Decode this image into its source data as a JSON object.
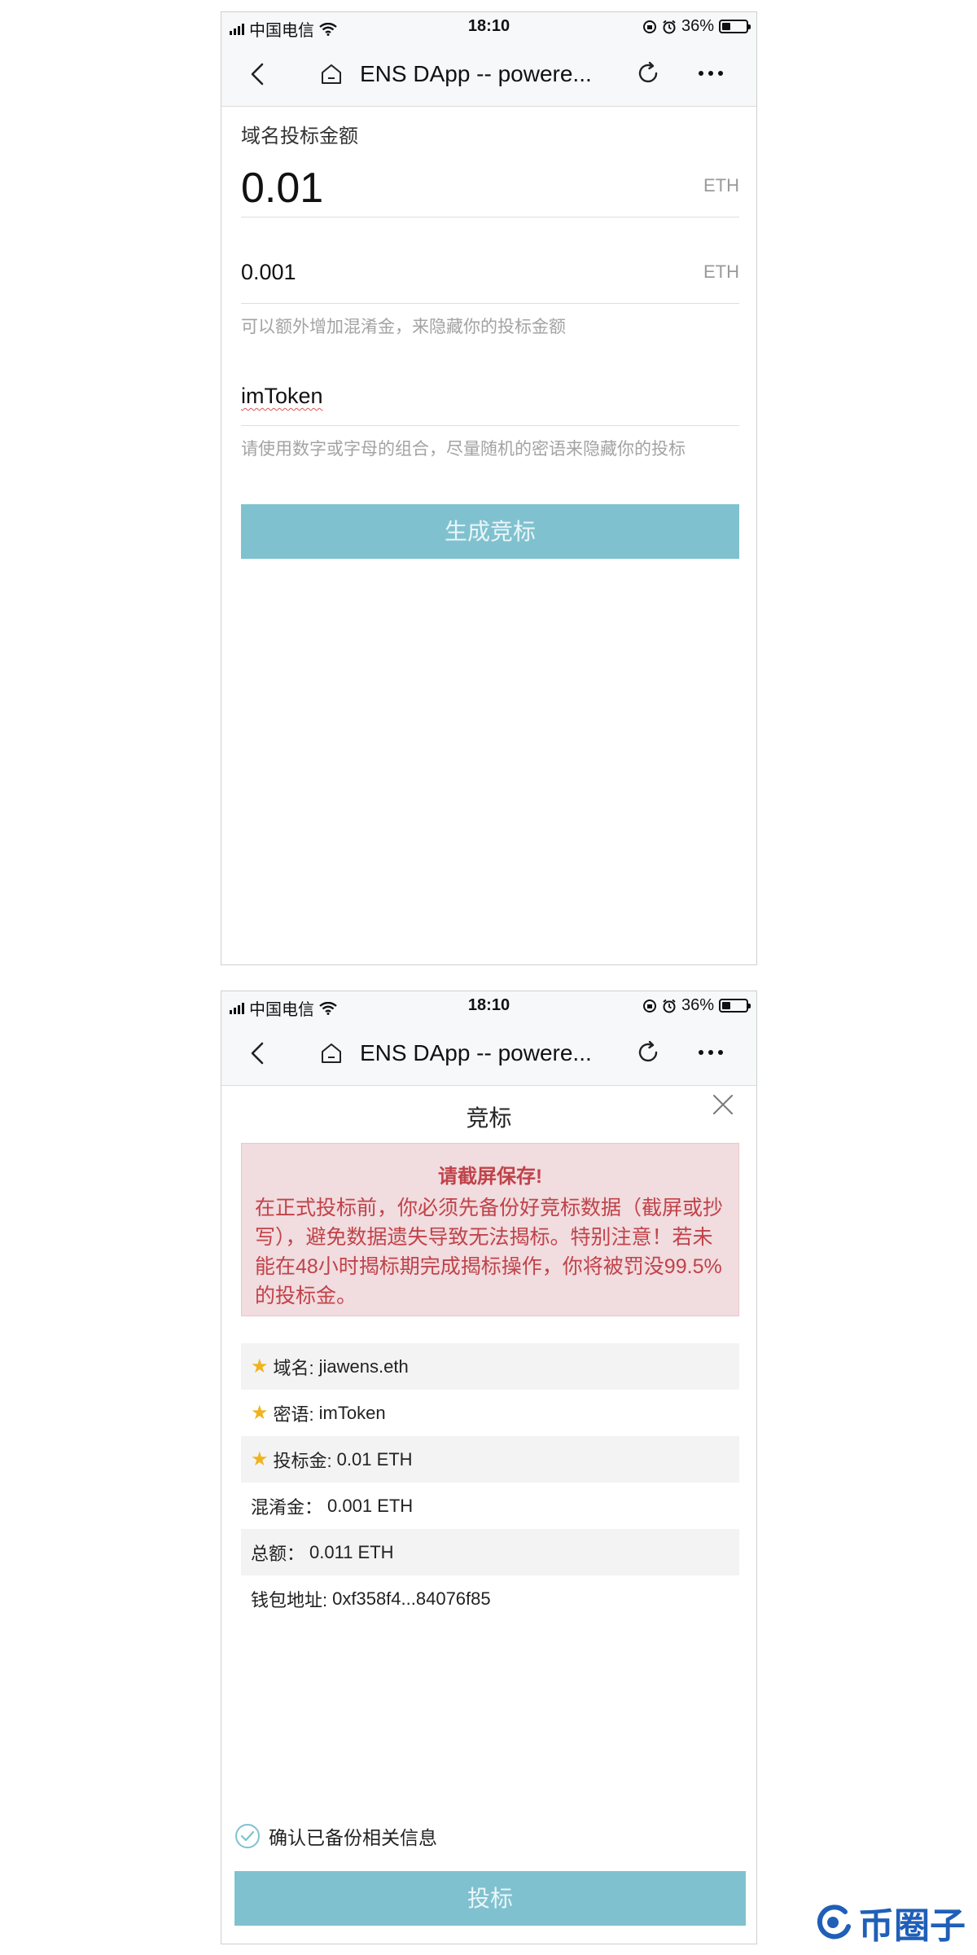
{
  "status": {
    "carrier": "中国电信",
    "time": "18:10",
    "battery": "36%",
    "battery_level": 0.36
  },
  "nav": {
    "title": "ENS DApp -- powere..."
  },
  "form": {
    "bid_label": "域名投标金额",
    "bid_value": "0.01",
    "bid_unit": "ETH",
    "mask_value": "0.001",
    "mask_unit": "ETH",
    "mask_hint": "可以额外增加混淆金，来隐藏你的投标金额",
    "secret_value": "imToken",
    "secret_hint": "请使用数字或字母的组合，尽量随机的密语来隐藏你的投标",
    "generate_label": "生成竞标"
  },
  "modal": {
    "title": "竞标",
    "warning_head": "请截屏保存!",
    "warning_body": "在正式投标前，你必须先备份好竞标数据（截屏或抄写），避免数据遗失导致无法揭标。特别注意！若未能在48小时揭标期完成揭标操作，你将被罚没99.5%的投标金。",
    "rows": [
      {
        "label": "域名:",
        "value": "jiawens.eth"
      },
      {
        "label": "密语:",
        "value": "imToken"
      },
      {
        "label": "投标金:",
        "value": "0.01 ETH"
      },
      {
        "label": "混淆金：",
        "value": "0.001 ETH"
      },
      {
        "label": "总额：",
        "value": "0.011 ETH"
      },
      {
        "label": "钱包地址:",
        "value": "0xf358f4...84076f85"
      }
    ],
    "confirm_label": "确认已备份相关信息",
    "bid_button": "投标"
  },
  "watermark": {
    "text": "币圈子"
  }
}
